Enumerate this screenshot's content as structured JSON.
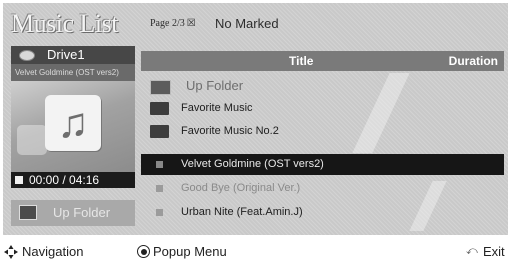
{
  "app": {
    "title": "Music List",
    "page_info": "Page 2/3",
    "mark_status": "No Marked"
  },
  "left_panel": {
    "drive_label": "Drive1",
    "current_track": "Velvet Goldmine (OST vers2)",
    "time": "00:00 / 04:16",
    "up_folder_label": "Up Folder"
  },
  "list": {
    "headers": {
      "title": "Title",
      "duration": "Duration"
    },
    "rows": [
      {
        "type": "up",
        "label": "Up Folder"
      },
      {
        "type": "folder",
        "label": "Favorite Music"
      },
      {
        "type": "folder",
        "label": "Favorite Music No.2"
      },
      {
        "type": "music",
        "label": "Velvet Goldmine (OST vers2)",
        "selected": true
      },
      {
        "type": "music",
        "label": "Good Bye (Original Ver.)"
      },
      {
        "type": "music",
        "label": "Urban Nite (Feat.Amin.J)"
      }
    ]
  },
  "footer": {
    "navigation_label": "Navigation",
    "popup_label": "Popup Menu",
    "exit_label": "Exit"
  },
  "colors": {
    "screen_bg": "#c9c9c9",
    "header_bg": "#7a7a7a",
    "selected_bg": "#161616",
    "drive_bar_bg": "#474747"
  },
  "icons": {
    "drive": "disk-icon",
    "album": "music-note-icon",
    "stop": "stop-icon",
    "folder": "folder-icon",
    "music": "music-file-icon",
    "navigation": "navigation-arrows-icon",
    "ok": "ok-button-icon",
    "exit": "exit-icon"
  }
}
